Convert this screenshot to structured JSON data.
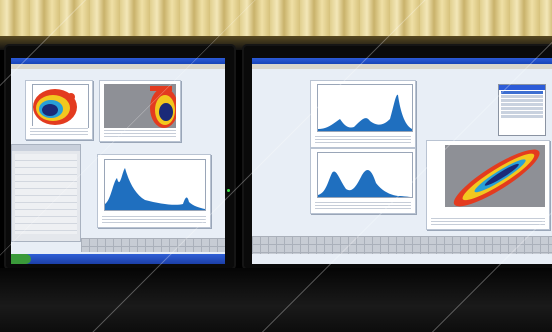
{
  "scene": {
    "description_elements": [
      "left-monitor",
      "right-monitor",
      "curtain",
      "desk"
    ]
  },
  "left_monitor": {
    "windows": [
      {
        "name": "dot-plot-1",
        "kind": "density-scatter"
      },
      {
        "name": "dot-plot-2",
        "kind": "density-scatter"
      },
      {
        "name": "histogram-1",
        "kind": "histogram"
      },
      {
        "name": "statistics-panel",
        "kind": "table"
      }
    ]
  },
  "right_monitor": {
    "windows": [
      {
        "name": "histogram-2",
        "kind": "histogram"
      },
      {
        "name": "histogram-3",
        "kind": "histogram"
      },
      {
        "name": "dot-plot-3",
        "kind": "density-scatter"
      },
      {
        "name": "experiment-browser",
        "kind": "tree"
      }
    ]
  },
  "colors": {
    "histogram_fill": "#1f6fbf",
    "density_high": "#1a2a78",
    "density_mid": "#f2c81f",
    "density_low": "#e33b1f",
    "window_title": "#1744b8",
    "taskbar": "#1c3fa8"
  }
}
